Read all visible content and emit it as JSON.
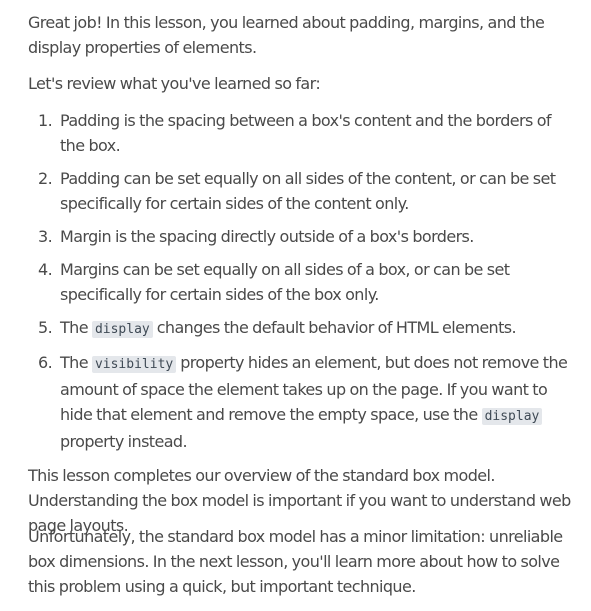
{
  "intro": {
    "congrats": "Great job! In this lesson, you learned about padding, margins, and the display properties of elements.",
    "review_lead": "Let's review what you've learned so far:"
  },
  "recap": {
    "items": [
      {
        "num": "1.",
        "text": "Padding is the spacing between a box's content and the borders of the box."
      },
      {
        "num": "2.",
        "text": "Padding can be set equally on all sides of the content, or can be set specifically for certain sides of the content only."
      },
      {
        "num": "3.",
        "text": "Margin is the spacing directly outside of a box's borders."
      },
      {
        "num": "4.",
        "text": "Margins can be set equally on all sides of a box, or can be set specifically for certain sides of the box only."
      },
      {
        "num": "5.",
        "pre": "The ",
        "code": "display",
        "post": " changes the default behavior of HTML elements."
      },
      {
        "num": "6.",
        "pre": "The ",
        "code": "visibility",
        "mid": " property hides an element, but does not remove the amount of space the element takes up on the page. If you want to hide that element and remove the empty space, use the ",
        "code2": "display",
        "post": " property instead."
      }
    ]
  },
  "outro": {
    "summary": "This lesson completes our overview of the standard box model. Understanding the box model is important if you want to understand web page layouts.",
    "next": "Unfortunately, the standard box model has a minor limitation: unreliable box dimensions. In the next lesson, you'll learn more about how to solve this problem using a quick, but important technique."
  }
}
